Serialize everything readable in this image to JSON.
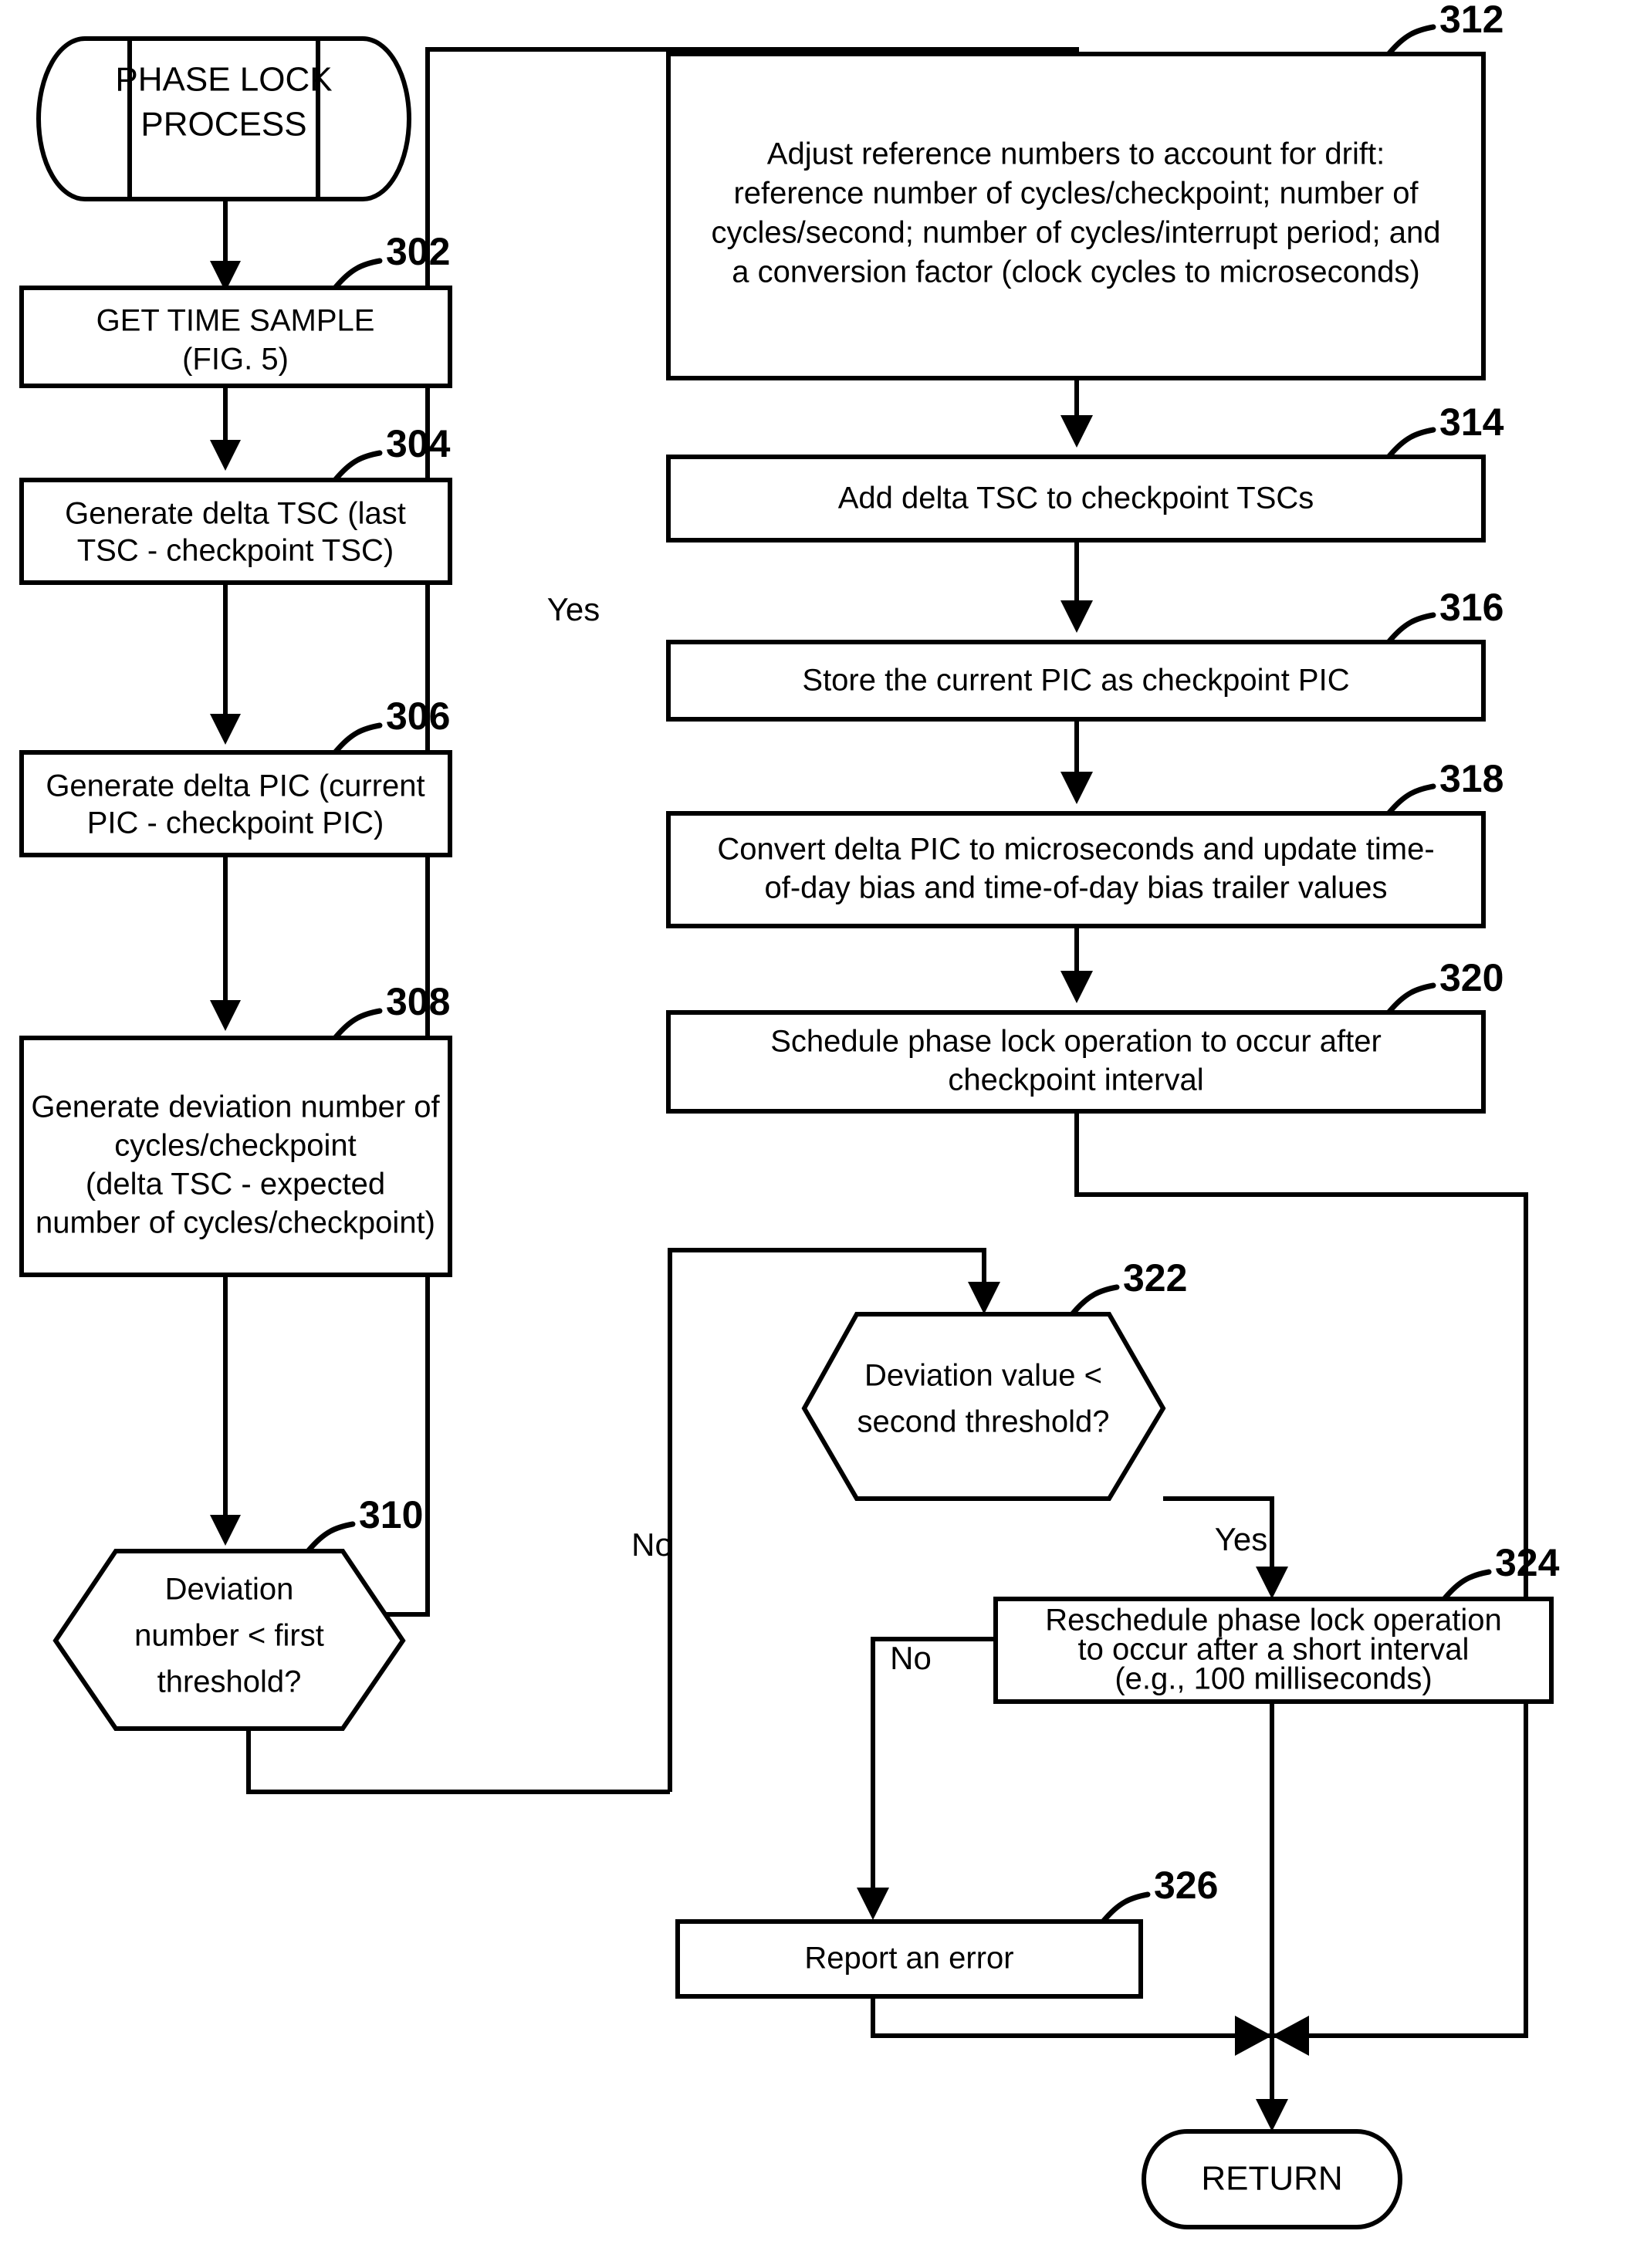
{
  "figure": {
    "title": "PHASE LOCK PROCESS flowchart",
    "line_color": "#000000",
    "fill_color": "#ffffff"
  },
  "nodes": {
    "start": {
      "kind": "terminator",
      "lines": [
        "PHASE LOCK",
        "PROCESS"
      ]
    },
    "n302": {
      "kind": "process",
      "ref": "302",
      "lines": [
        "GET TIME SAMPLE",
        "(FIG. 5)"
      ]
    },
    "n304": {
      "kind": "process",
      "ref": "304",
      "lines": [
        "Generate delta TSC (last",
        "TSC - checkpoint TSC)"
      ]
    },
    "n306": {
      "kind": "process",
      "ref": "306",
      "lines": [
        "Generate delta PIC (current",
        "PIC - checkpoint PIC)"
      ]
    },
    "n308": {
      "kind": "process",
      "ref": "308",
      "lines": [
        "Generate deviation number of",
        "cycles/checkpoint",
        "(delta TSC - expected",
        "number of cycles/checkpoint)"
      ]
    },
    "n310": {
      "kind": "decision",
      "ref": "310",
      "lines": [
        "Deviation",
        "number < first",
        "threshold?"
      ]
    },
    "n312": {
      "kind": "process",
      "ref": "312",
      "lines": [
        "Adjust reference numbers to account for drift:",
        "reference number of cycles/checkpoint; number of",
        "cycles/second; number of cycles/interrupt period; and",
        "a conversion factor (clock cycles to microseconds)"
      ]
    },
    "n314": {
      "kind": "process",
      "ref": "314",
      "lines": [
        "Add delta TSC to checkpoint TSCs"
      ]
    },
    "n316": {
      "kind": "process",
      "ref": "316",
      "lines": [
        "Store the current PIC as checkpoint PIC"
      ]
    },
    "n318": {
      "kind": "process",
      "ref": "318",
      "lines": [
        "Convert delta PIC to microseconds and update time-",
        "of-day bias and time-of-day bias trailer values"
      ]
    },
    "n320": {
      "kind": "process",
      "ref": "320",
      "lines": [
        "Schedule phase lock operation to occur after",
        "checkpoint interval"
      ]
    },
    "n322": {
      "kind": "decision",
      "ref": "322",
      "lines": [
        "Deviation value <",
        "second threshold?"
      ]
    },
    "n324": {
      "kind": "process",
      "ref": "324",
      "lines": [
        "Reschedule phase lock operation",
        "to occur after a short interval",
        "(e.g., 100 milliseconds)"
      ]
    },
    "n326": {
      "kind": "process",
      "ref": "326",
      "lines": [
        "Report an error"
      ]
    },
    "end": {
      "kind": "terminator",
      "lines": [
        "RETURN"
      ]
    }
  },
  "edge_labels": {
    "yes_310": "Yes",
    "no_310": "No",
    "yes_322": "Yes",
    "no_322": "No"
  }
}
